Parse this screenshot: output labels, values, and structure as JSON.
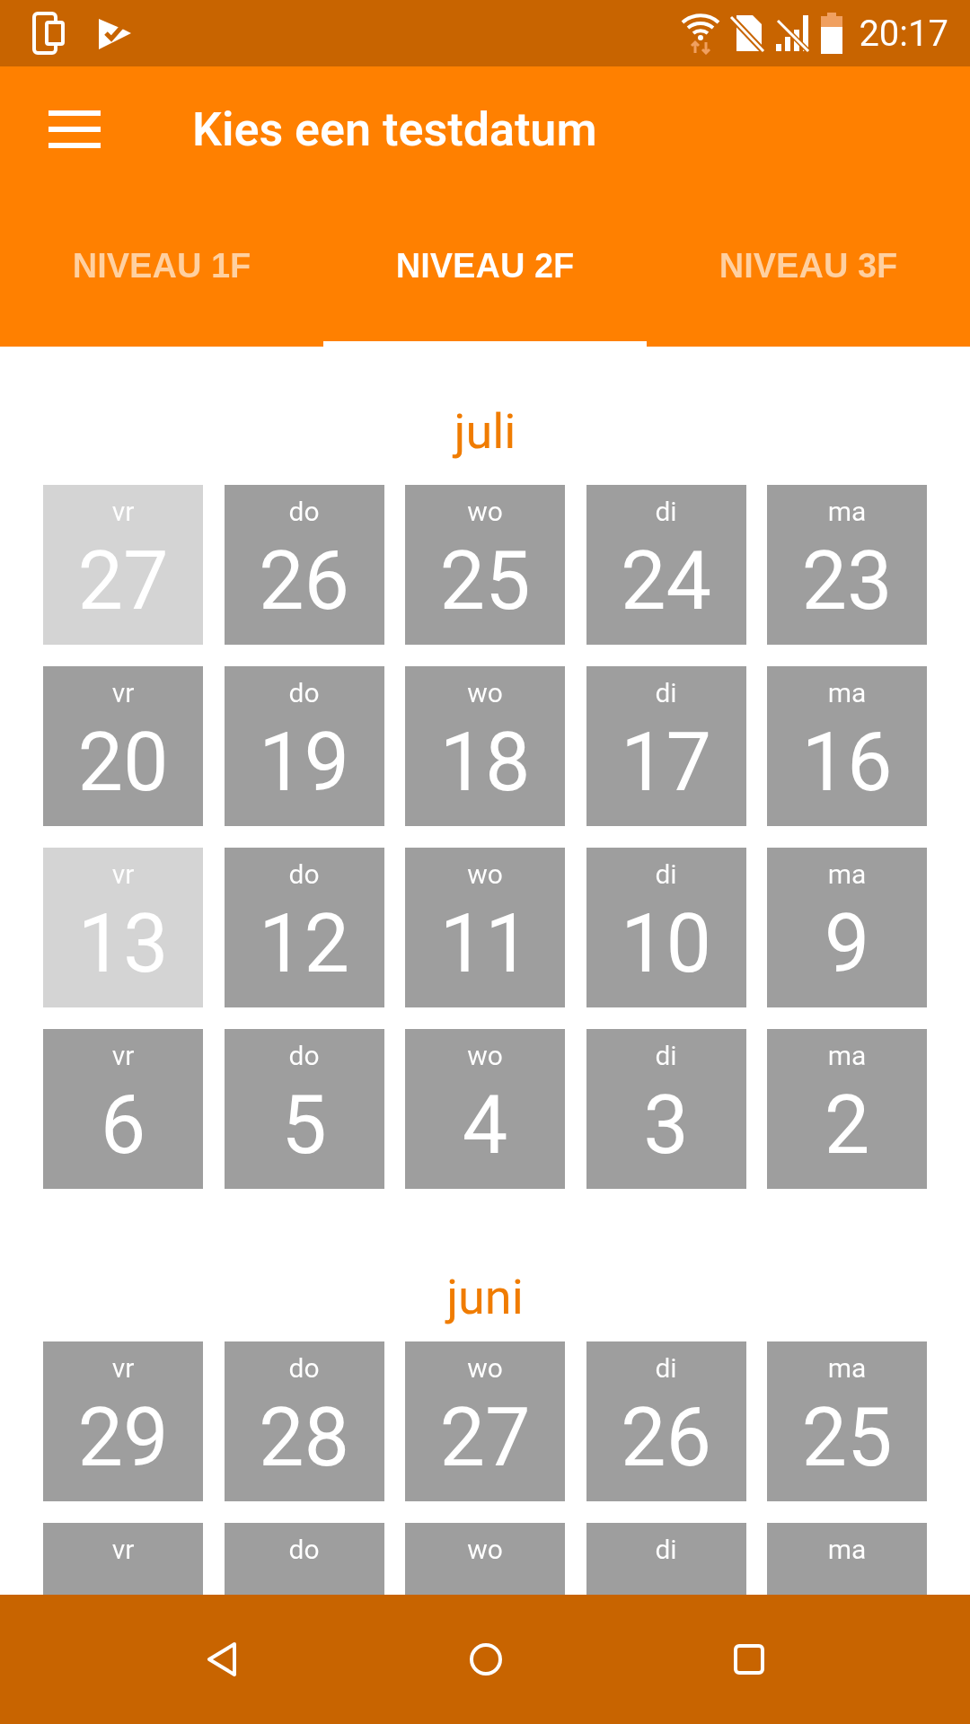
{
  "status_bar": {
    "time": "20:17"
  },
  "app_bar": {
    "title": "Kies een testdatum"
  },
  "tabs": [
    {
      "label": "NIVEAU 1F",
      "selected": false
    },
    {
      "label": "NIVEAU 2F",
      "selected": true
    },
    {
      "label": "NIVEAU 3F",
      "selected": false
    }
  ],
  "months": [
    {
      "name": "juli",
      "weeks": [
        [
          {
            "weekday": "vr",
            "day": "27",
            "disabled": true
          },
          {
            "weekday": "do",
            "day": "26",
            "disabled": false
          },
          {
            "weekday": "wo",
            "day": "25",
            "disabled": false
          },
          {
            "weekday": "di",
            "day": "24",
            "disabled": false
          },
          {
            "weekday": "ma",
            "day": "23",
            "disabled": false
          }
        ],
        [
          {
            "weekday": "vr",
            "day": "20",
            "disabled": false
          },
          {
            "weekday": "do",
            "day": "19",
            "disabled": false
          },
          {
            "weekday": "wo",
            "day": "18",
            "disabled": false
          },
          {
            "weekday": "di",
            "day": "17",
            "disabled": false
          },
          {
            "weekday": "ma",
            "day": "16",
            "disabled": false
          }
        ],
        [
          {
            "weekday": "vr",
            "day": "13",
            "disabled": true
          },
          {
            "weekday": "do",
            "day": "12",
            "disabled": false
          },
          {
            "weekday": "wo",
            "day": "11",
            "disabled": false
          },
          {
            "weekday": "di",
            "day": "10",
            "disabled": false
          },
          {
            "weekday": "ma",
            "day": "9",
            "disabled": false
          }
        ],
        [
          {
            "weekday": "vr",
            "day": "6",
            "disabled": false
          },
          {
            "weekday": "do",
            "day": "5",
            "disabled": false
          },
          {
            "weekday": "wo",
            "day": "4",
            "disabled": false
          },
          {
            "weekday": "di",
            "day": "3",
            "disabled": false
          },
          {
            "weekday": "ma",
            "day": "2",
            "disabled": false
          }
        ]
      ]
    },
    {
      "name": "juni",
      "weeks": [
        [
          {
            "weekday": "vr",
            "day": "29",
            "disabled": false
          },
          {
            "weekday": "do",
            "day": "28",
            "disabled": false
          },
          {
            "weekday": "wo",
            "day": "27",
            "disabled": false
          },
          {
            "weekday": "di",
            "day": "26",
            "disabled": false
          },
          {
            "weekday": "ma",
            "day": "25",
            "disabled": false
          }
        ],
        [
          {
            "weekday": "vr",
            "disabled": false
          },
          {
            "weekday": "do",
            "disabled": false
          },
          {
            "weekday": "wo",
            "disabled": false
          },
          {
            "weekday": "di",
            "disabled": false
          },
          {
            "weekday": "ma",
            "disabled": false
          }
        ]
      ]
    }
  ]
}
